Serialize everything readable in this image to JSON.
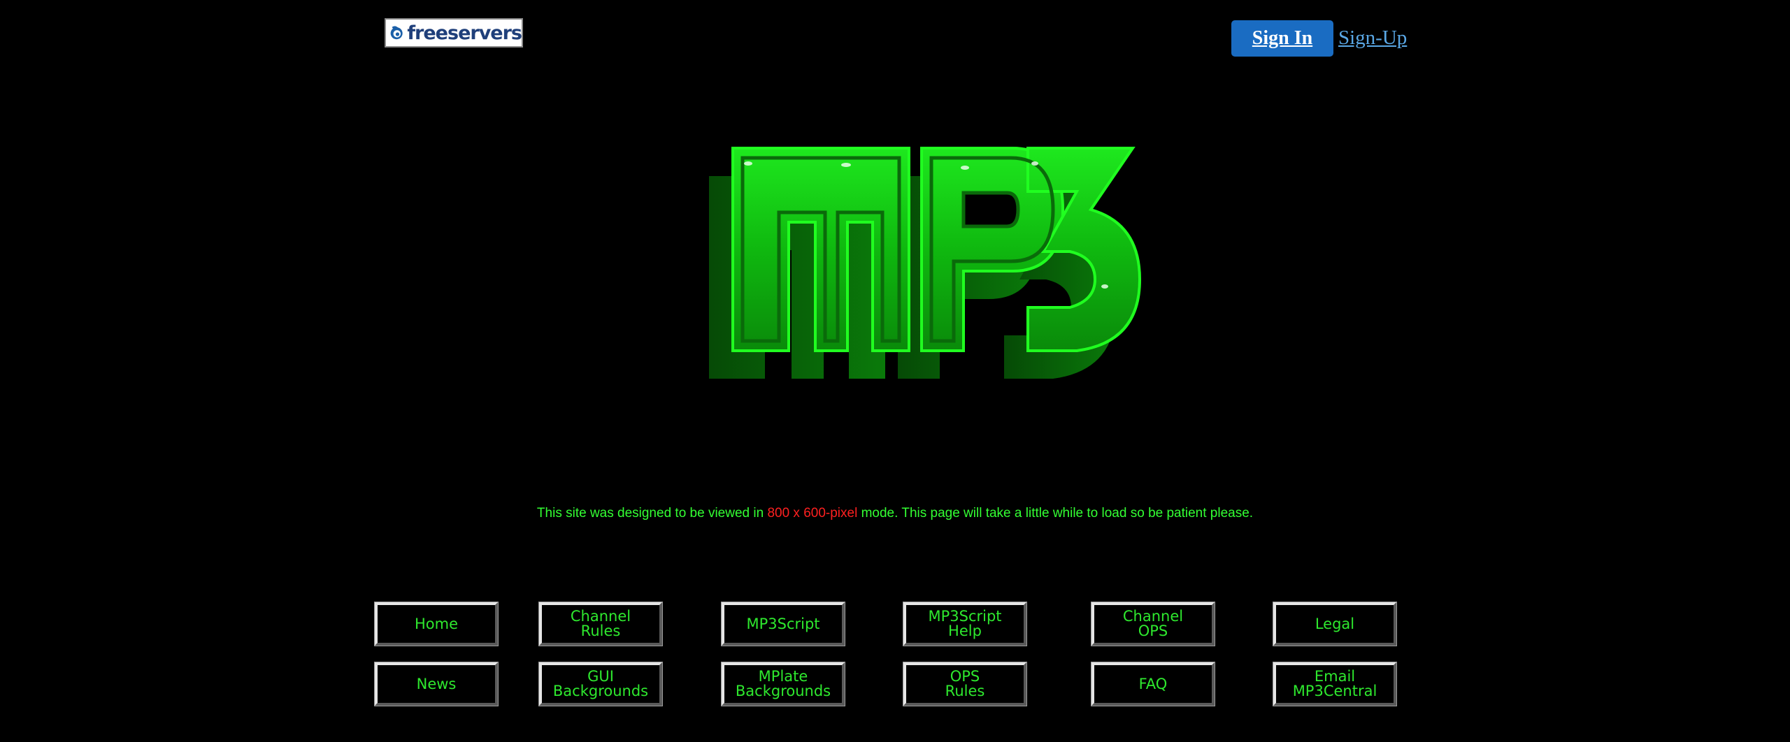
{
  "header": {
    "logo_text": "freeservers",
    "signin_label": "Sign In",
    "signup_label": "Sign-Up"
  },
  "hero": {
    "logo_text": "MP3",
    "logo_color": "#00c800"
  },
  "notice": {
    "part1": "This site was designed to be viewed in ",
    "highlight": "800 x 600-pixel",
    "part2": " mode. This page will take a little while to load so be patient please."
  },
  "colors": {
    "background": "#000000",
    "text_green": "#33ff33",
    "highlight_red": "#ff2020",
    "signin_blue": "#1a6cc2",
    "signup_link": "#5aa8e6"
  },
  "nav": {
    "row1": [
      {
        "label": "Home"
      },
      {
        "label": "Channel\nRules"
      },
      {
        "label": "MP3Script"
      },
      {
        "label": "MP3Script\nHelp"
      },
      {
        "label": "Channel\nOPS"
      },
      {
        "label": "Legal"
      }
    ],
    "row2": [
      {
        "label": "News"
      },
      {
        "label": "GUI\nBackgrounds"
      },
      {
        "label": "MPlate\nBackgrounds"
      },
      {
        "label": "OPS\nRules"
      },
      {
        "label": "FAQ"
      },
      {
        "label": "Email\nMP3Central"
      }
    ]
  }
}
